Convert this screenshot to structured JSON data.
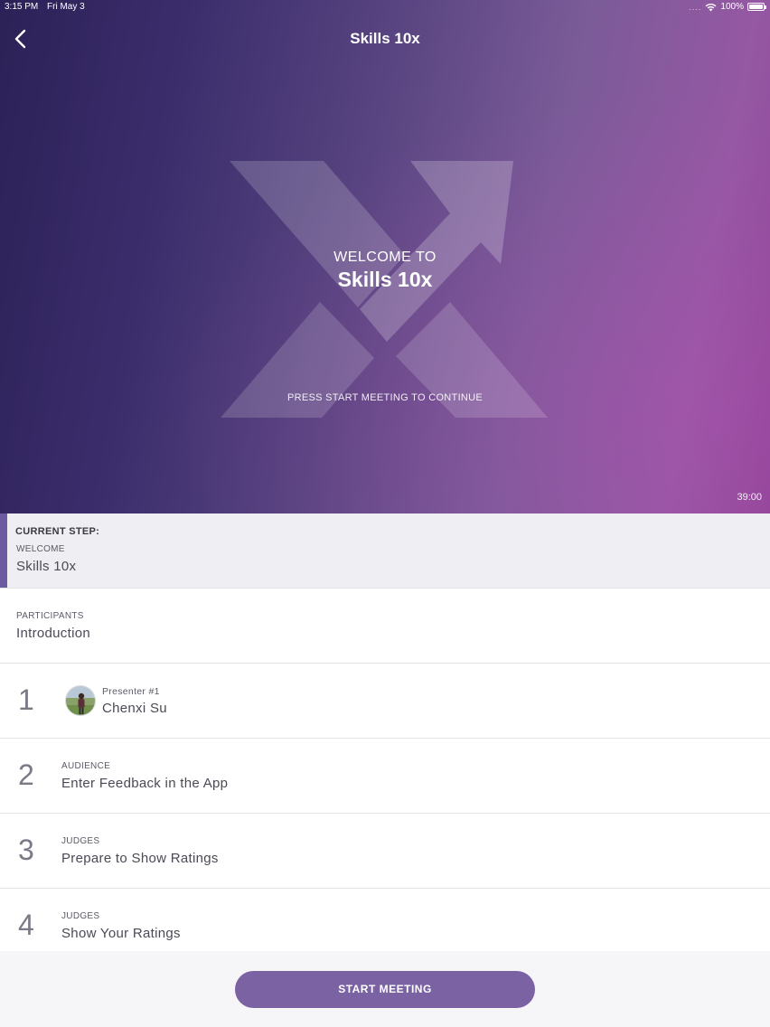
{
  "status_bar": {
    "time": "3:15 PM",
    "date": "Fri May 3",
    "signal": "....",
    "battery": "100%"
  },
  "nav": {
    "title": "Skills 10x",
    "back_icon": "chevron-left-icon"
  },
  "hero": {
    "welcome_pre": "WELCOME TO",
    "welcome_title": "Skills 10x",
    "press_hint": "PRESS START MEETING TO CONTINUE",
    "timer": "39:00",
    "logo_icon": "skills-10x-logo"
  },
  "current_step": {
    "label": "CURRENT STEP:",
    "kicker": "WELCOME",
    "title": "Skills 10x"
  },
  "participants_step": {
    "kicker": "PARTICIPANTS",
    "title": "Introduction"
  },
  "steps": [
    {
      "number": "1",
      "kicker": "Presenter #1",
      "title": "Chenxi Su"
    },
    {
      "number": "2",
      "kicker": "AUDIENCE",
      "title": "Enter Feedback in the App"
    },
    {
      "number": "3",
      "kicker": "JUDGES",
      "title": "Prepare to Show Ratings"
    },
    {
      "number": "4",
      "kicker": "JUDGES",
      "title": "Show Your Ratings"
    }
  ],
  "footer": {
    "start_label": "START MEETING"
  },
  "colors": {
    "accent": "#7a62a3",
    "current_bar": "#6c5b9e",
    "hero_dark": "#2c2157",
    "hero_light": "#9558a3"
  }
}
